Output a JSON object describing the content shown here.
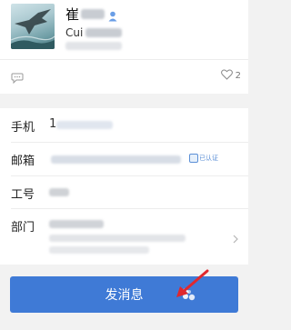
{
  "profile": {
    "name_initial": "崔",
    "sub_prefix": "Cui"
  },
  "stats": {
    "likes_count": "2"
  },
  "info": {
    "phone_label": "手机",
    "phone_prefix": "1",
    "email_label": "邮箱",
    "email_verified_label": "已认证",
    "employee_id_label": "工号",
    "department_label": "部门"
  },
  "actions": {
    "send_message_label": "发消息"
  },
  "colors": {
    "primary_button": "#3f7ad6",
    "background": "#f2f2f2",
    "card": "#ffffff",
    "arrow": "#e0282e"
  },
  "icons": [
    "person-icon",
    "chat-bubble-icon",
    "heart-icon",
    "verified-icon",
    "chevron-right-icon",
    "sparkle-icon"
  ]
}
